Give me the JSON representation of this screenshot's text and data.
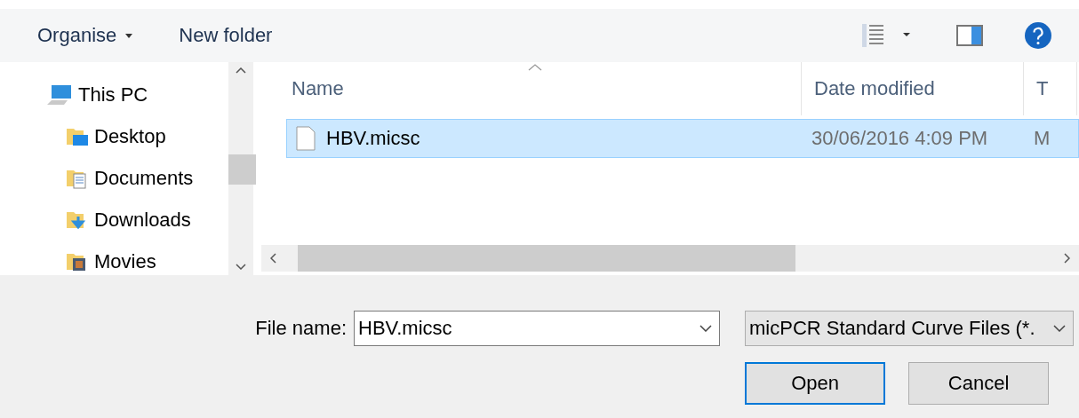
{
  "toolbar": {
    "organise": "Organise",
    "new_folder": "New folder"
  },
  "navigation": [
    {
      "label": "This PC",
      "kind": "pc",
      "children": [
        {
          "label": "Desktop",
          "kind": "desktop"
        },
        {
          "label": "Documents",
          "kind": "documents"
        },
        {
          "label": "Downloads",
          "kind": "downloads"
        },
        {
          "label": "Movies",
          "kind": "movies"
        }
      ]
    }
  ],
  "columns": [
    "Name",
    "Date modified",
    "T"
  ],
  "rows": [
    {
      "name": "HBV.micsc",
      "date": "30/06/2016 4:09 PM",
      "column_3": "M",
      "selected": true
    }
  ],
  "file_name": {
    "label": "File name:",
    "value": "HBV.micsc"
  },
  "file_type": {
    "value": "micPCR Standard Curve Files (*."
  },
  "buttons": [
    {
      "label": "Open",
      "default": true
    },
    {
      "label": "Cancel",
      "default": false
    }
  ]
}
